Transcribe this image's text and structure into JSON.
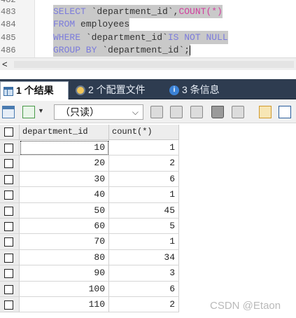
{
  "editor": {
    "line_numbers": [
      "482",
      "483",
      "484",
      "485",
      "486"
    ],
    "line_483": {
      "kw1": "SELECT",
      "id1": " `department_id`,",
      "fn": "COUNT",
      "id2": "(*)"
    },
    "line_484": {
      "kw1": "FROM",
      "id1": " employees"
    },
    "line_485": {
      "kw1": "WHERE",
      "id1": " `department_id`",
      "kw2": "IS NOT NULL"
    },
    "line_486": {
      "kw1": "GROUP BY",
      "id1": " `department_id`;"
    },
    "scroll_arrow": "<"
  },
  "tabs": [
    {
      "label": "1 个结果",
      "icon": "result-grid-icon"
    },
    {
      "label": "2 个配置文件",
      "icon": "profile-icon"
    },
    {
      "label": "3 条信息",
      "icon": "info-icon",
      "icon_glyph": "i"
    }
  ],
  "toolbar": {
    "mode_select": "（只读）",
    "chevron": "⌵",
    "dropdown_arrow": "▼"
  },
  "grid": {
    "columns": [
      "department_id",
      "count(*)"
    ],
    "rows": [
      [
        "10",
        "1"
      ],
      [
        "20",
        "2"
      ],
      [
        "30",
        "6"
      ],
      [
        "40",
        "1"
      ],
      [
        "50",
        "45"
      ],
      [
        "60",
        "5"
      ],
      [
        "70",
        "1"
      ],
      [
        "80",
        "34"
      ],
      [
        "90",
        "3"
      ],
      [
        "100",
        "6"
      ],
      [
        "110",
        "2"
      ]
    ]
  },
  "watermark": "CSDN @Etaon",
  "colors": {
    "tab_bar": "#2e3c50",
    "keyword": "#7b7bdc",
    "function": "#d23e9e",
    "selection": "#c9c9c9"
  }
}
